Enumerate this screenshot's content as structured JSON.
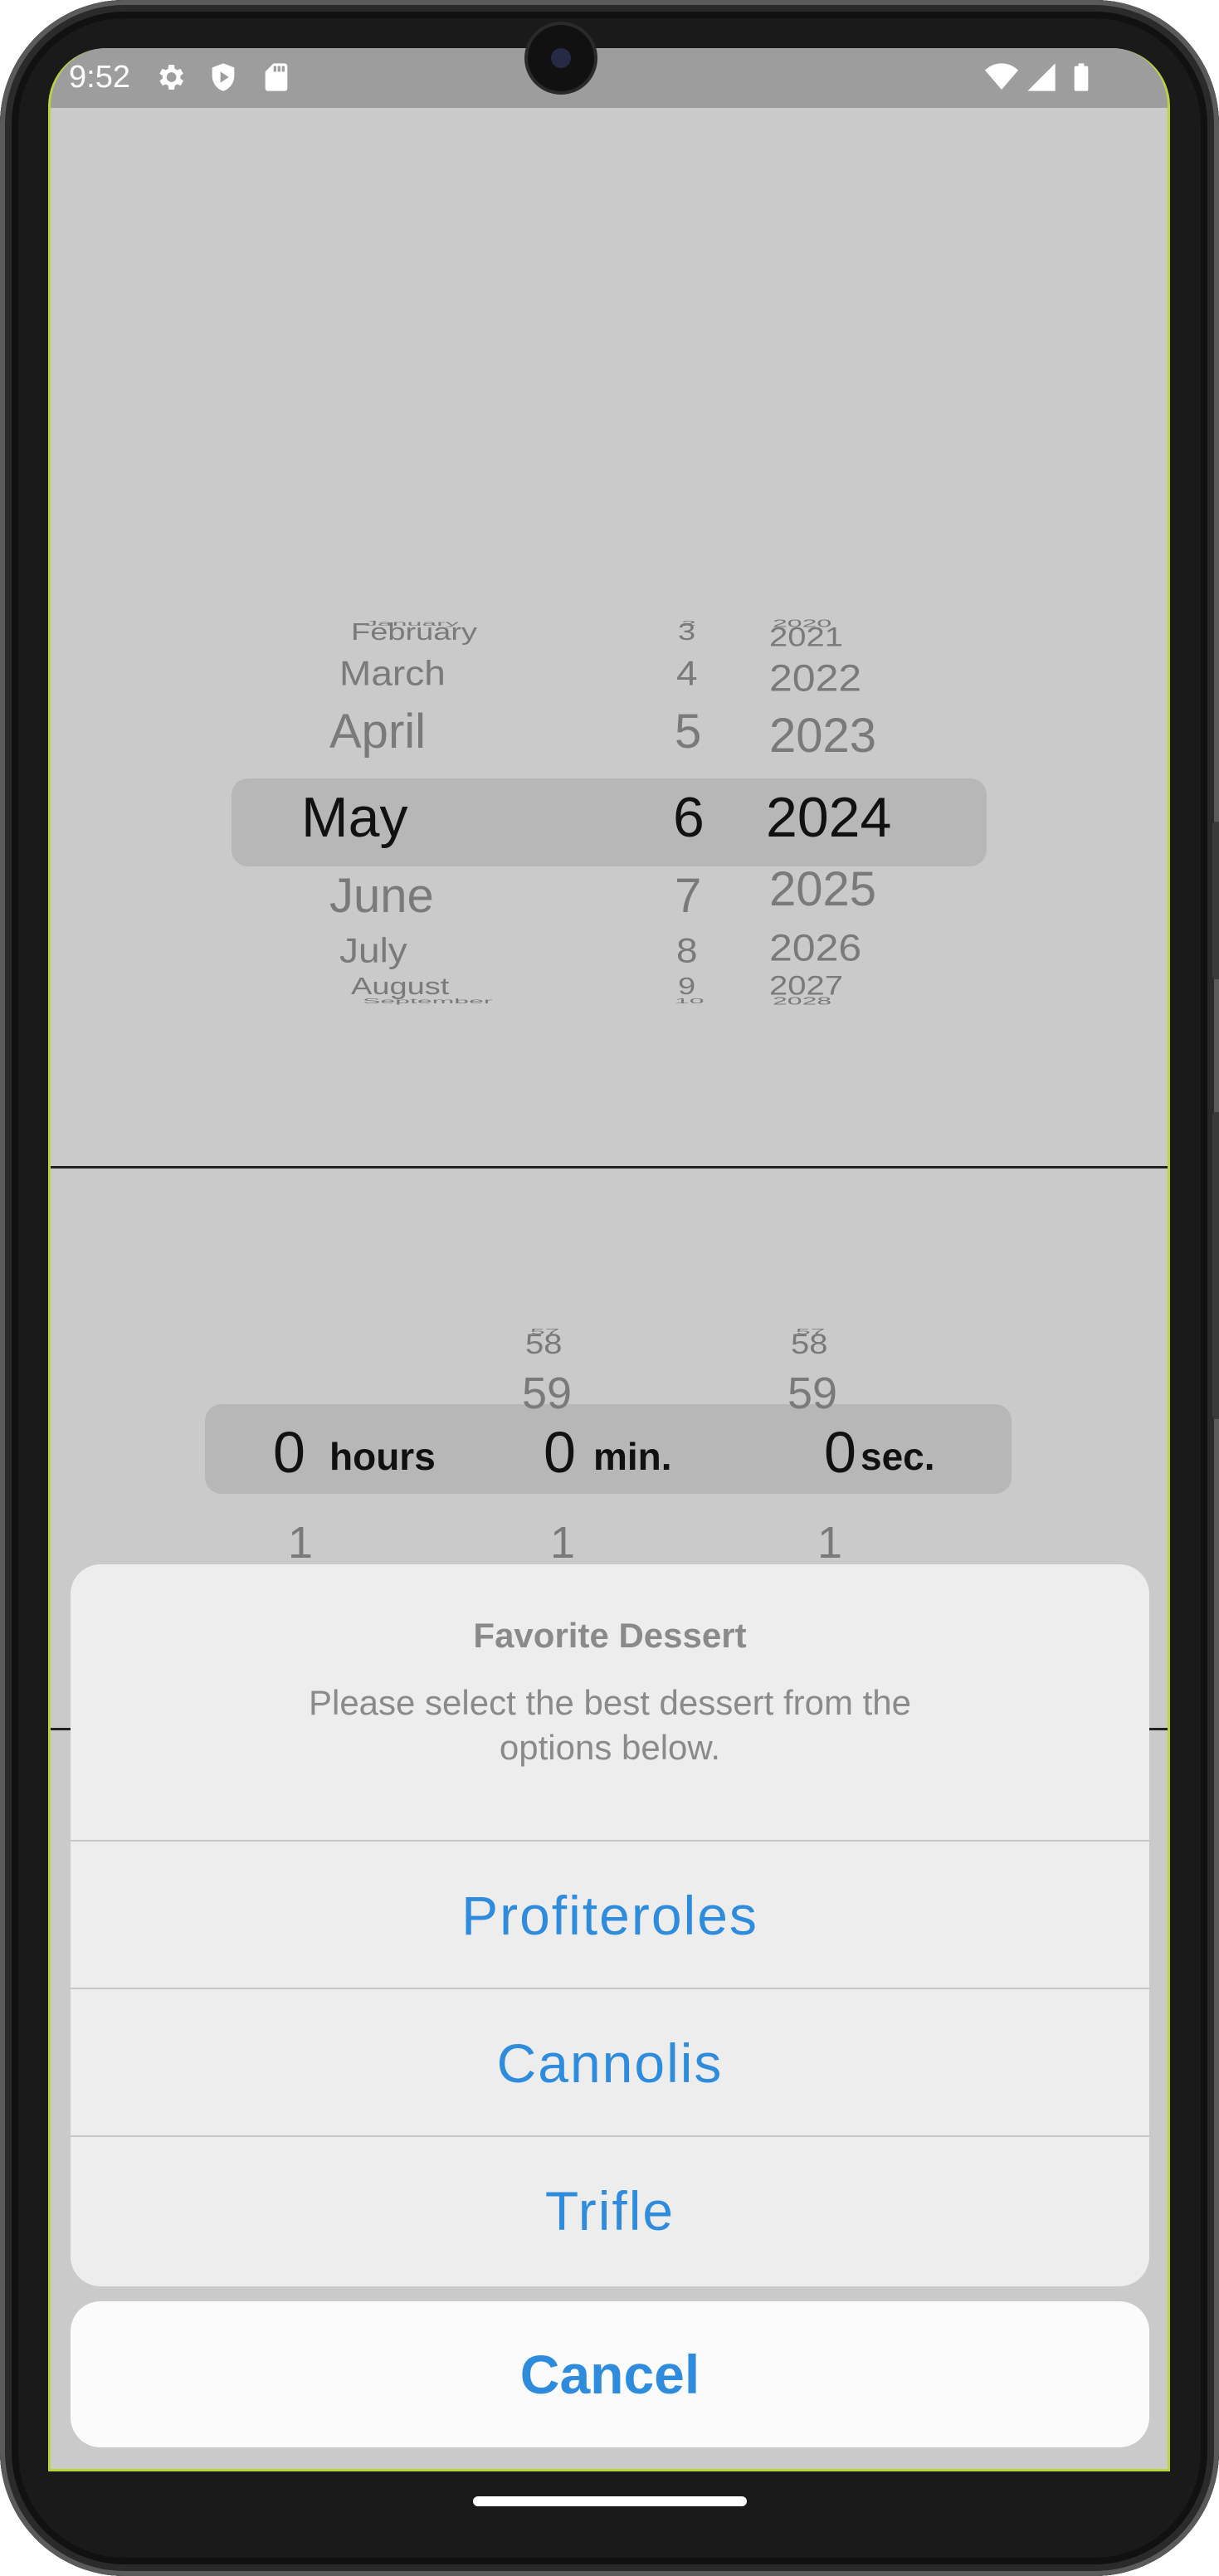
{
  "status": {
    "time": "9:52"
  },
  "date_picker": {
    "months": [
      "January",
      "February",
      "March",
      "April",
      "May",
      "June",
      "July",
      "August",
      "September"
    ],
    "days": [
      "2",
      "3",
      "4",
      "5",
      "6",
      "7",
      "8",
      "9",
      "10"
    ],
    "years": [
      "2020",
      "2021",
      "2022",
      "2023",
      "2024",
      "2025",
      "2026",
      "2027",
      "2028"
    ],
    "selected": {
      "month": "May",
      "day": "6",
      "year": "2024"
    }
  },
  "duration_picker": {
    "minutes_above": [
      "57",
      "58",
      "59"
    ],
    "seconds_above": [
      "57",
      "58",
      "59"
    ],
    "selected": {
      "hours": "0",
      "minutes": "0",
      "seconds": "0"
    },
    "labels": {
      "hours": "hours",
      "minutes": "min.",
      "seconds": "sec."
    },
    "below": {
      "hours": "1",
      "minutes": "1",
      "seconds": "1"
    }
  },
  "action_sheet": {
    "title": "Favorite Dessert",
    "message": "Please select the best dessert from the options below.",
    "options": [
      "Profiteroles",
      "Cannolis",
      "Trifle"
    ],
    "cancel": "Cancel"
  },
  "colors": {
    "accent": "#2f8cdc",
    "screen_bg": "#cacaca",
    "sheet_bg": "#ededed"
  },
  "icons": [
    "settings-icon",
    "play-protect-icon",
    "sd-card-icon",
    "wifi-icon",
    "cell-signal-icon",
    "battery-icon"
  ]
}
